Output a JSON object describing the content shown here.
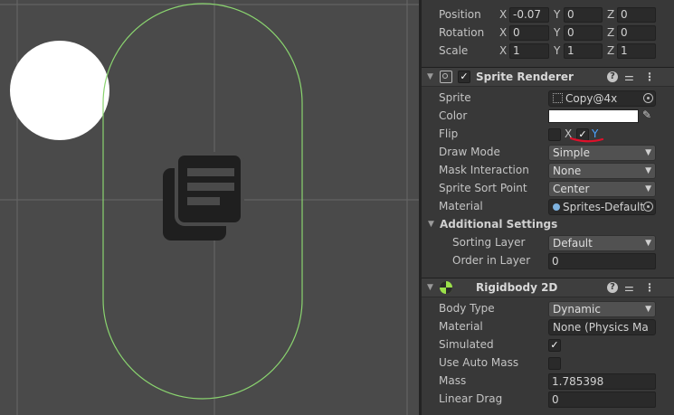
{
  "scene": {
    "icon": "document-stack-icon"
  },
  "transform": {
    "position": {
      "label": "Position",
      "x": "-0.07",
      "y": "0",
      "z": "0"
    },
    "rotation": {
      "label": "Rotation",
      "x": "0",
      "y": "0",
      "z": "0"
    },
    "scale": {
      "label": "Scale",
      "x": "1",
      "y": "1",
      "z": "1"
    },
    "axis_x": "X",
    "axis_y": "Y",
    "axis_z": "Z"
  },
  "sprite_renderer": {
    "title": "Sprite Renderer",
    "help": "?",
    "sprite_label": "Sprite",
    "sprite_value": "Copy@4x",
    "color_label": "Color",
    "color_value": "#ffffff",
    "flip_label": "Flip",
    "flip_x": "X",
    "flip_y": "Y",
    "flip_x_checked": false,
    "flip_y_checked": true,
    "draw_mode_label": "Draw Mode",
    "draw_mode_value": "Simple",
    "mask_label": "Mask Interaction",
    "mask_value": "None",
    "sort_point_label": "Sprite Sort Point",
    "sort_point_value": "Center",
    "material_label": "Material",
    "material_value": "Sprites-Default",
    "additional_title": "Additional Settings",
    "sorting_layer_label": "Sorting Layer",
    "sorting_layer_value": "Default",
    "order_label": "Order in Layer",
    "order_value": "0"
  },
  "rigidbody": {
    "title": "Rigidbody 2D",
    "help": "?",
    "body_type_label": "Body Type",
    "body_type_value": "Dynamic",
    "material_label": "Material",
    "material_value": "None (Physics Ma",
    "simulated_label": "Simulated",
    "simulated_checked": true,
    "auto_mass_label": "Use Auto Mass",
    "auto_mass_checked": false,
    "mass_label": "Mass",
    "mass_value": "1.785398",
    "linear_drag_label": "Linear Drag",
    "linear_drag_value": "0"
  },
  "icons": {
    "sliders": "sliders-icon",
    "kebab": "kebab-menu-icon",
    "picker": "object-picker-icon",
    "eyedropper": "eyedropper-icon",
    "dropdown": "chevron-down-icon",
    "fold": "fold-arrow-icon"
  },
  "colors": {
    "scene_bg": "#4a4a4a",
    "grid": "#6a6a6a",
    "collider": "#8ad46f",
    "inspector_bg": "#383838",
    "annotation": "#e0102a",
    "check_blue": "#4aa3ff"
  }
}
